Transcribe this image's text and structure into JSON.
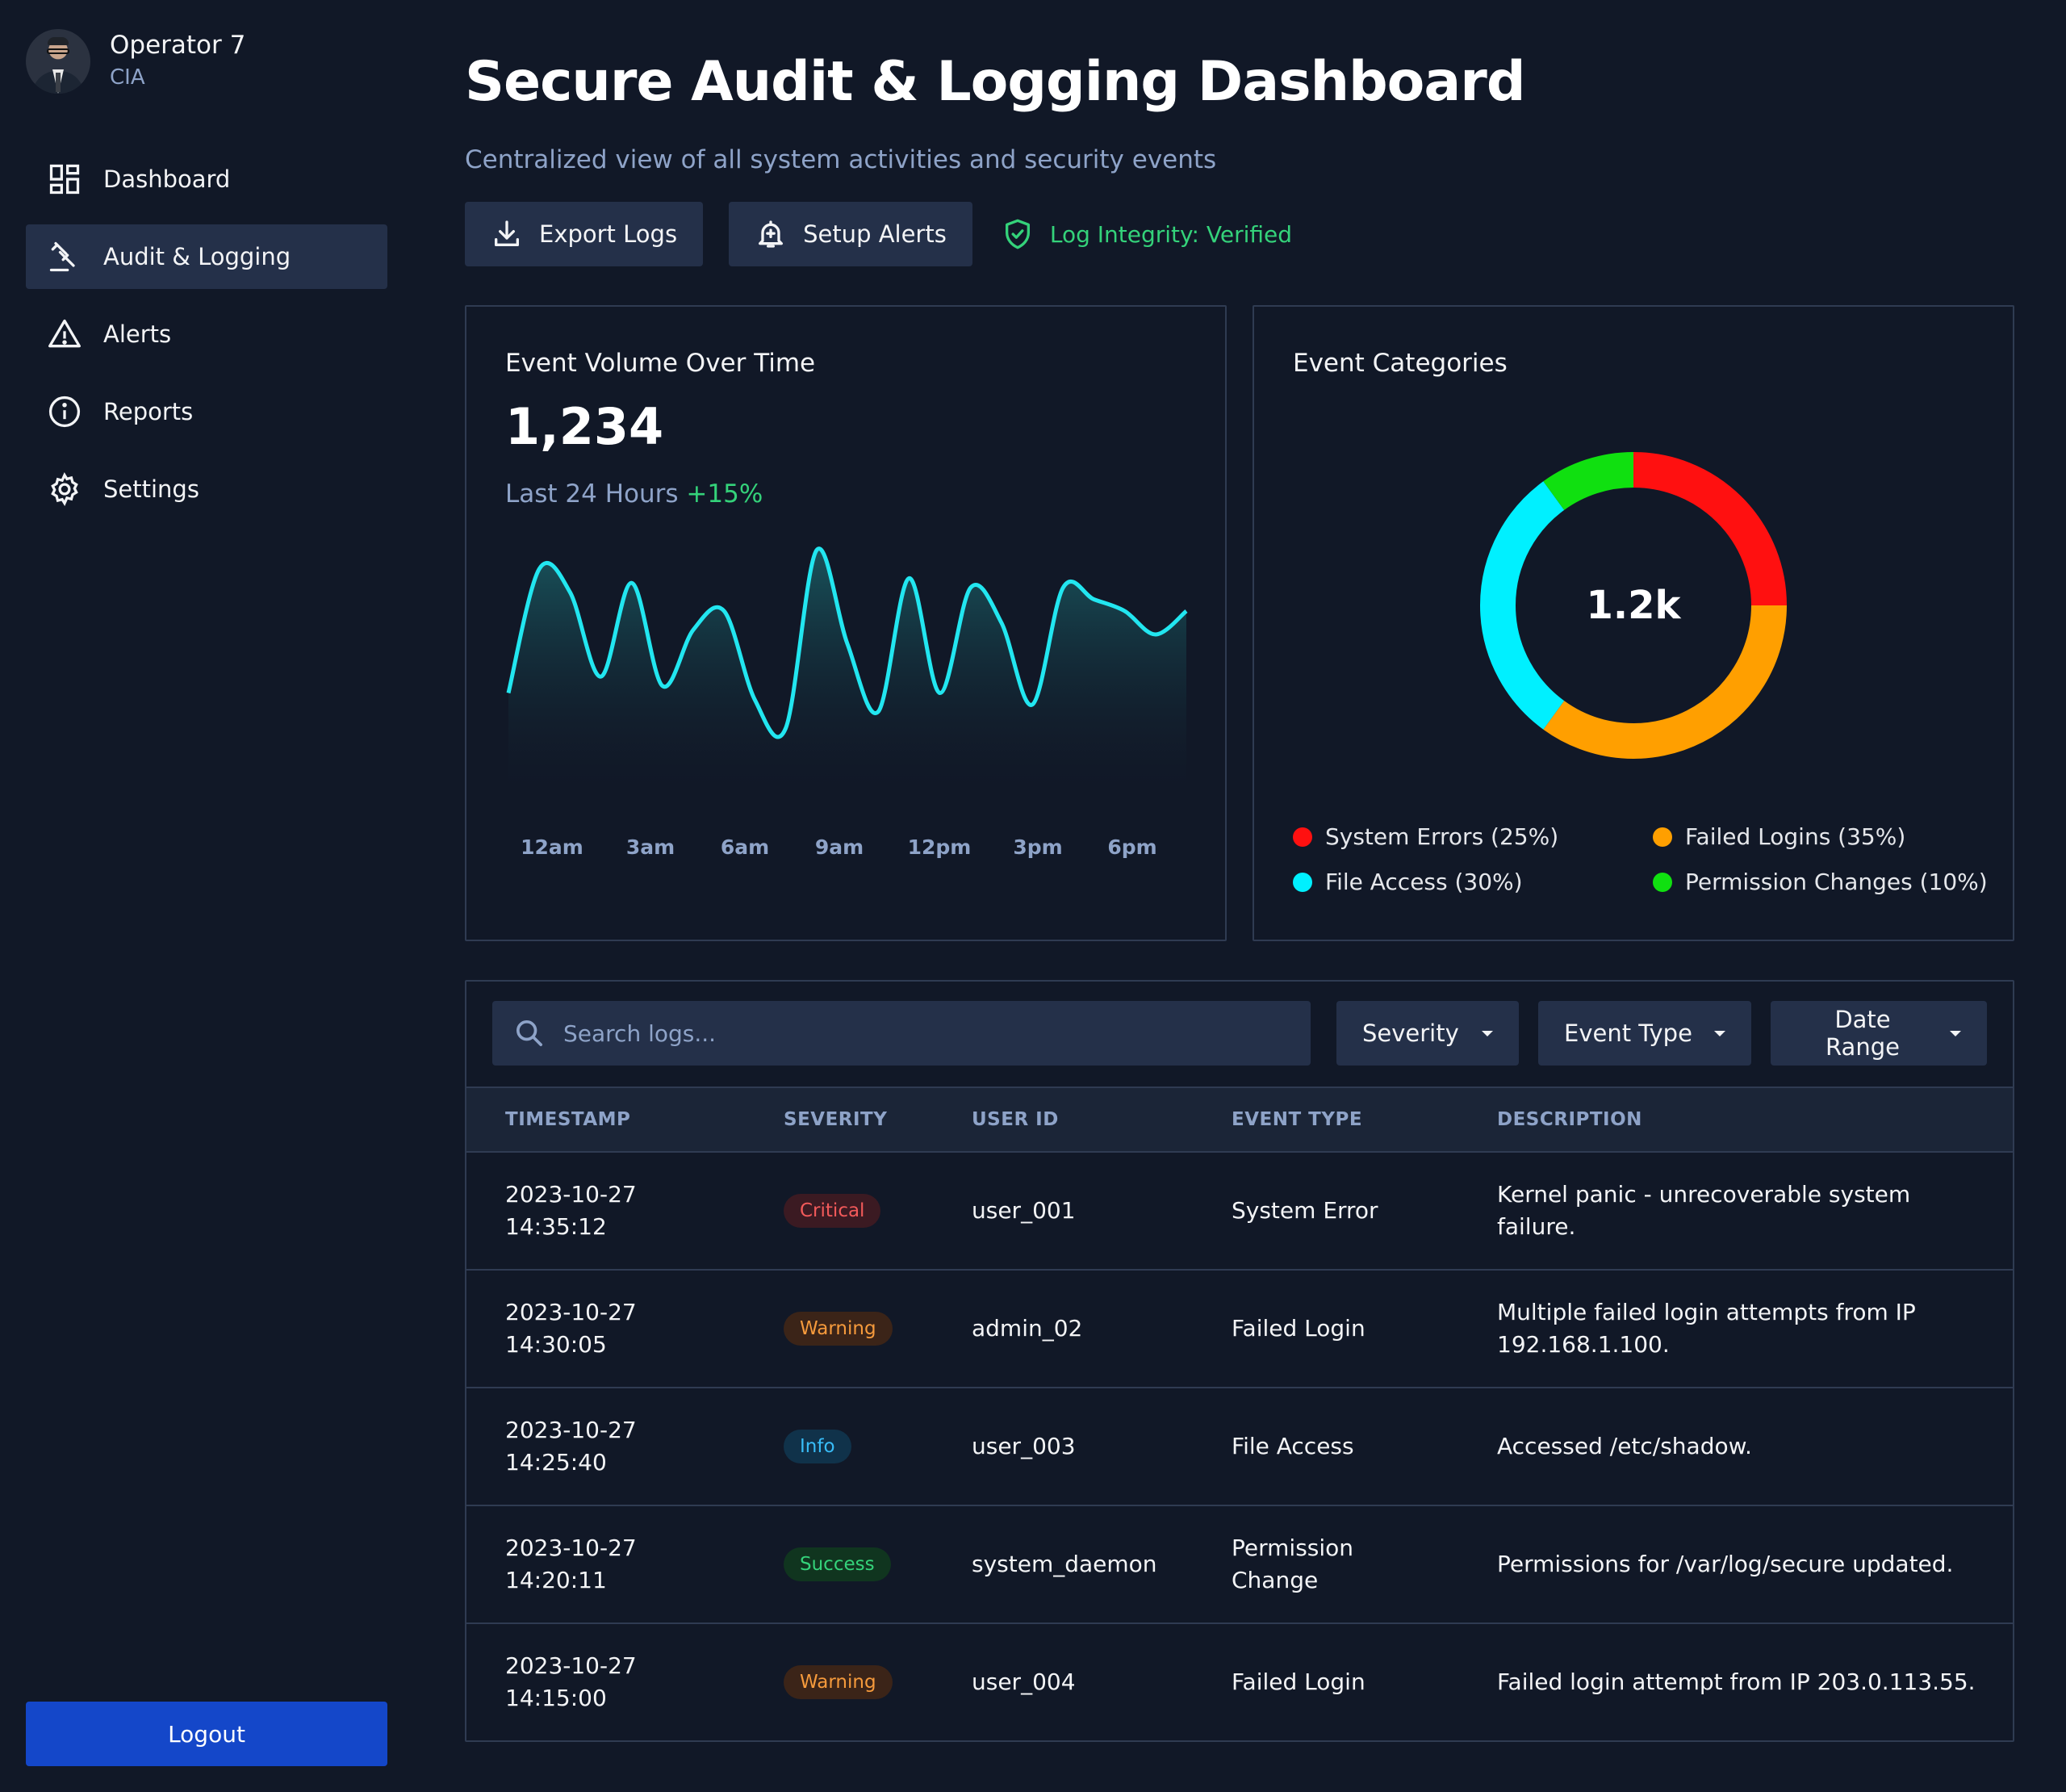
{
  "user": {
    "name": "Operator 7",
    "org": "CIA"
  },
  "nav": {
    "items": [
      {
        "label": "Dashboard",
        "icon": "dashboard-icon"
      },
      {
        "label": "Audit & Logging",
        "icon": "gavel-icon",
        "active": true
      },
      {
        "label": "Alerts",
        "icon": "warning-icon"
      },
      {
        "label": "Reports",
        "icon": "info-icon"
      },
      {
        "label": "Settings",
        "icon": "gear-icon"
      }
    ],
    "logout_label": "Logout"
  },
  "header": {
    "title": "Secure Audit & Logging Dashboard",
    "subtitle": "Centralized view of all system activities and security events",
    "export_label": "Export Logs",
    "alerts_label": "Setup Alerts",
    "integrity_label": "Log Integrity: Verified"
  },
  "colors": {
    "accent": "#22e6f0",
    "primary_button": "#1447c9",
    "success": "#34d27a",
    "system_errors": "#ff1010",
    "failed_logins": "#ff9f00",
    "file_access": "#00f0ff",
    "permission_changes": "#10e010"
  },
  "volume": {
    "title": "Event Volume Over Time",
    "total": "1,234",
    "period": "Last 24 Hours",
    "delta": "+15%"
  },
  "chart_data": [
    {
      "type": "area",
      "title": "Event Volume Over Time",
      "x": [
        "12am",
        "3am",
        "6am",
        "9am",
        "12pm",
        "3pm",
        "6pm"
      ],
      "x_ticks": [
        "12am",
        "3am",
        "6am",
        "9am",
        "12pm",
        "3pm",
        "6pm"
      ],
      "series": [
        {
          "hours": [
            0,
            1,
            2,
            3,
            4,
            5,
            6,
            7,
            8,
            9,
            10,
            11,
            12,
            13,
            14,
            15,
            16,
            17,
            18,
            19,
            20,
            21,
            22
          ],
          "values": [
            35,
            88,
            78,
            42,
            82,
            38,
            62,
            70,
            32,
            20,
            96,
            56,
            27,
            84,
            35,
            80,
            65,
            30,
            80,
            75,
            70,
            60,
            70
          ]
        }
      ],
      "grid": false,
      "legend": "none"
    },
    {
      "type": "pie",
      "title": "Event Categories",
      "center_label": "1.2k",
      "slices": [
        {
          "label": "System Errors (25%)",
          "value": 25,
          "color": "#ff1010"
        },
        {
          "label": "Failed Logins (35%)",
          "value": 35,
          "color": "#ff9f00"
        },
        {
          "label": "File Access (30%)",
          "value": 30,
          "color": "#00f0ff"
        },
        {
          "label": "Permission Changes (10%)",
          "value": 10,
          "color": "#10e010"
        }
      ],
      "legend": "bottom"
    }
  ],
  "categories": {
    "title": "Event Categories",
    "center": "1.2k",
    "legend": [
      {
        "label": "System Errors (25%)",
        "color": "#ff1010"
      },
      {
        "label": "Failed Logins (35%)",
        "color": "#ff9f00"
      },
      {
        "label": "File Access (30%)",
        "color": "#00f0ff"
      },
      {
        "label": "Permission Changes (10%)",
        "color": "#10e010"
      }
    ]
  },
  "filters": {
    "search_placeholder": "Search logs...",
    "severity_label": "Severity",
    "event_type_label": "Event Type",
    "date_range_label": "Date Range"
  },
  "table": {
    "columns": [
      "TIMESTAMP",
      "SEVERITY",
      "USER ID",
      "EVENT TYPE",
      "DESCRIPTION"
    ],
    "rows": [
      {
        "date": "2023-10-27",
        "time": "14:35:12",
        "severity": "Critical",
        "user": "user_001",
        "event_type": "System Error",
        "description": "Kernel panic - unrecoverable system failure."
      },
      {
        "date": "2023-10-27",
        "time": "14:30:05",
        "severity": "Warning",
        "user": "admin_02",
        "event_type": "Failed Login",
        "description": "Multiple failed login attempts from IP 192.168.1.100."
      },
      {
        "date": "2023-10-27",
        "time": "14:25:40",
        "severity": "Info",
        "user": "user_003",
        "event_type": "File Access",
        "description": "Accessed /etc/shadow."
      },
      {
        "date": "2023-10-27",
        "time": "14:20:11",
        "severity": "Success",
        "user": "system_daemon",
        "event_type": "Permission Change",
        "description": "Permissions for /var/log/secure updated."
      },
      {
        "date": "2023-10-27",
        "time": "14:15:00",
        "severity": "Warning",
        "user": "user_004",
        "event_type": "Failed Login",
        "description": "Failed login attempt from IP 203.0.113.55."
      }
    ]
  }
}
